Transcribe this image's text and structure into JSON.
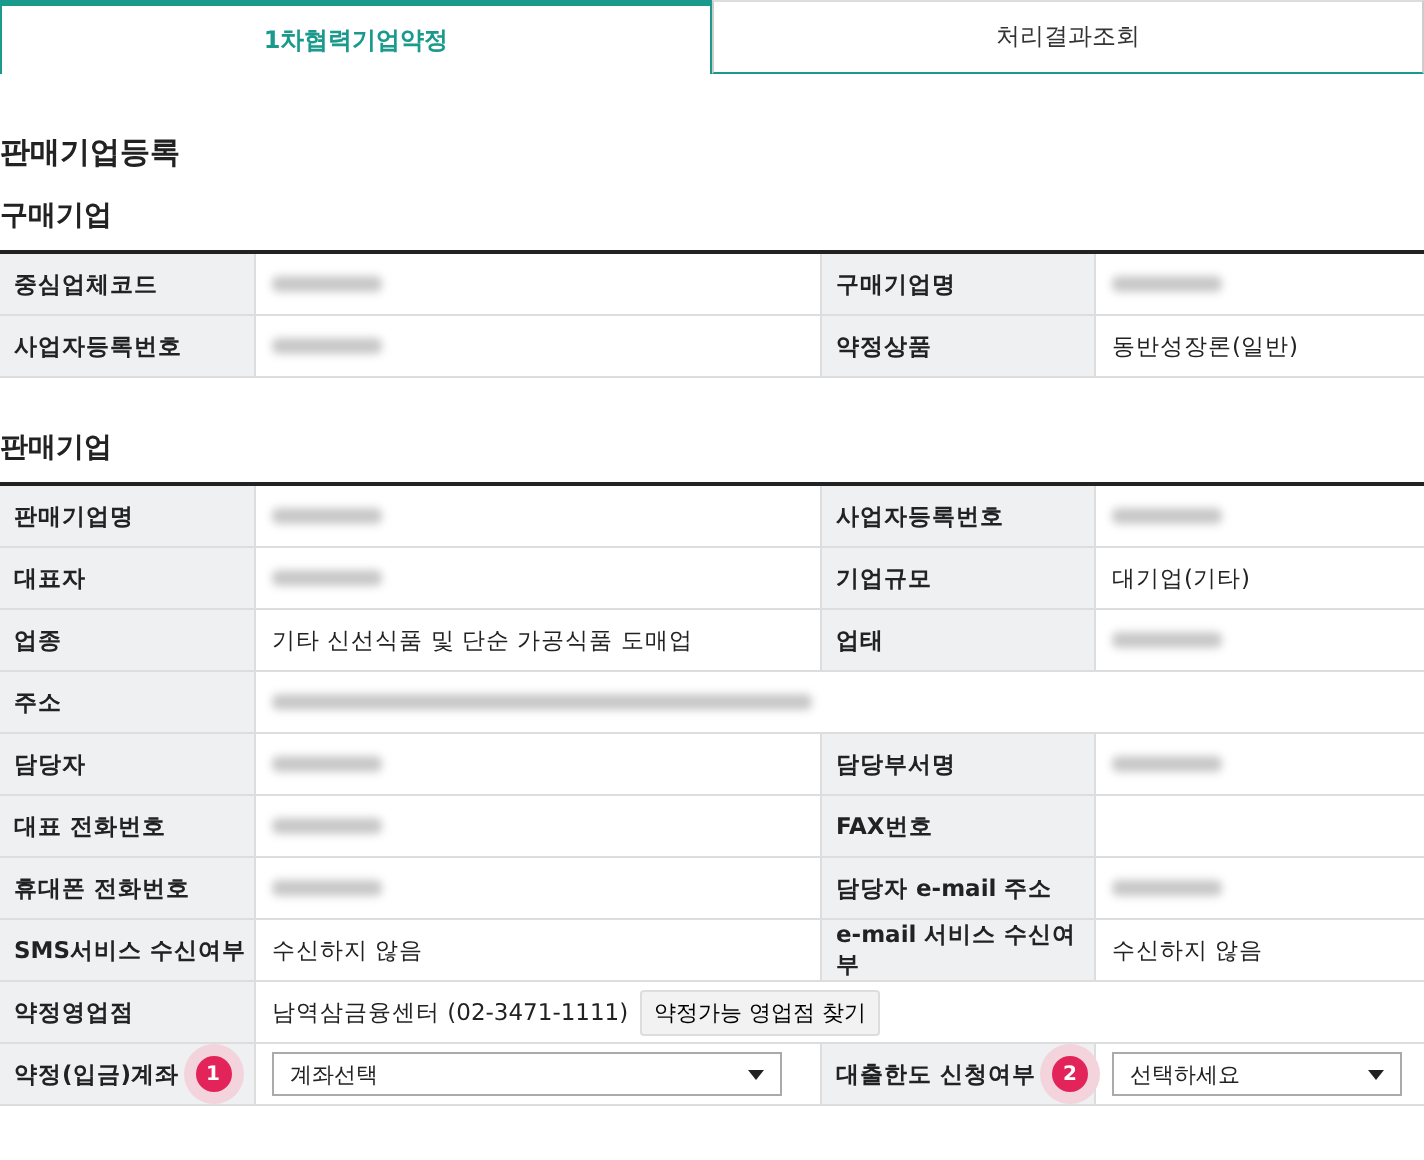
{
  "tabs": [
    {
      "label": "1차협력기업약정",
      "selected": true
    },
    {
      "label": "처리결과조회",
      "selected": false
    }
  ],
  "page_title": "판매기업등록",
  "sections": [
    {
      "title": "구매기업",
      "rows": [
        {
          "fields": [
            {
              "label": "중심업체코드",
              "value": {
                "kind": "redacted"
              }
            },
            {
              "label": "구매기업명",
              "value": {
                "kind": "redacted"
              }
            }
          ]
        },
        {
          "fields": [
            {
              "label": "사업자등록번호",
              "value": {
                "kind": "redacted"
              }
            },
            {
              "label": "약정상품",
              "value": {
                "kind": "text",
                "text": "동반성장론(일반)"
              }
            }
          ]
        }
      ]
    },
    {
      "title": "판매기업",
      "rows": [
        {
          "fields": [
            {
              "label": "판매기업명",
              "value": {
                "kind": "redacted"
              }
            },
            {
              "label": "사업자등록번호",
              "value": {
                "kind": "redacted"
              }
            }
          ]
        },
        {
          "fields": [
            {
              "label": "대표자",
              "value": {
                "kind": "redacted"
              }
            },
            {
              "label": "기업규모",
              "value": {
                "kind": "text",
                "text": "대기업(기타)"
              }
            }
          ]
        },
        {
          "fields": [
            {
              "label": "업종",
              "value": {
                "kind": "text",
                "text": "기타 신선식품 및 단순 가공식품 도매업"
              }
            },
            {
              "label": "업태",
              "value": {
                "kind": "redacted"
              }
            }
          ]
        },
        {
          "fields": [
            {
              "label": "주소",
              "value": {
                "kind": "redacted_long"
              }
            }
          ]
        },
        {
          "fields": [
            {
              "label": "담당자",
              "value": {
                "kind": "redacted"
              }
            },
            {
              "label": "담당부서명",
              "value": {
                "kind": "redacted"
              }
            }
          ]
        },
        {
          "fields": [
            {
              "label": "대표 전화번호",
              "value": {
                "kind": "redacted"
              }
            },
            {
              "label": "FAX번호",
              "value": {
                "kind": "empty"
              }
            }
          ]
        },
        {
          "fields": [
            {
              "label": "휴대폰 전화번호",
              "value": {
                "kind": "redacted"
              }
            },
            {
              "label": "담당자 e-mail 주소",
              "value": {
                "kind": "redacted"
              }
            }
          ]
        },
        {
          "fields": [
            {
              "label": "SMS서비스 수신여부",
              "value": {
                "kind": "text",
                "text": "수신하지 않음"
              }
            },
            {
              "label": "e-mail 서비스 수신여부",
              "value": {
                "kind": "text",
                "text": "수신하지 않음"
              }
            }
          ]
        },
        {
          "fields": [
            {
              "label": "약정영업점",
              "value": {
                "kind": "text_button",
                "text": "남역삼금융센터 (02-3471-1111)",
                "button": "약정가능 영업점 찾기"
              }
            }
          ]
        },
        {
          "fields": [
            {
              "label": "약정(입금)계좌",
              "badge": "1",
              "value": {
                "kind": "select",
                "text": "계좌선택"
              }
            },
            {
              "label": "대출한도 신청여부",
              "badge": "2",
              "value": {
                "kind": "select",
                "text": "선택하세요"
              }
            }
          ]
        }
      ]
    }
  ]
}
